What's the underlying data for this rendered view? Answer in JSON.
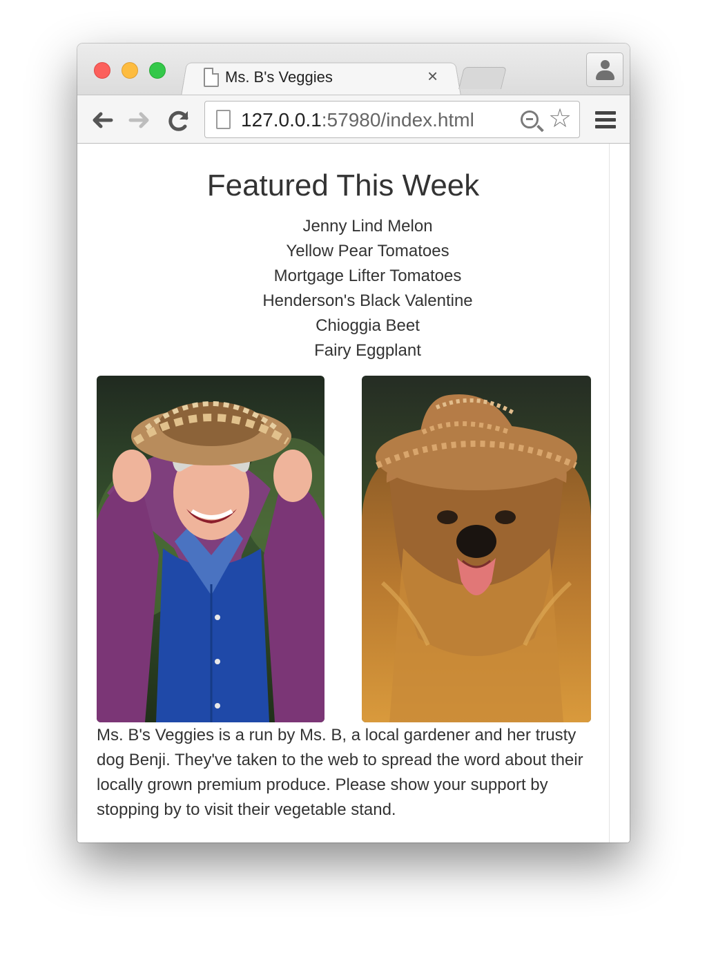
{
  "browser": {
    "tab_title": "Ms. B's Veggies",
    "tab_close": "×",
    "url_host": "127.0.0.1",
    "url_rest": ":57980/index.html",
    "icons": [
      "back-arrow-icon",
      "forward-arrow-icon",
      "reload-icon",
      "page-icon",
      "zoom-icon",
      "star-icon",
      "menu-icon",
      "profile-icon"
    ]
  },
  "page": {
    "heading": "Featured This Week",
    "featured_items": [
      "Jenny Lind Melon",
      "Yellow Pear Tomatoes",
      "Mortgage Lifter Tomatoes",
      "Henderson's Black Valentine",
      "Chioggia Beet",
      "Fairy Eggplant"
    ],
    "description": "Ms. B's Veggies is a run by Ms. B, a local gardener and her trusty dog Benji. They've taken to the web to spread the word about their locally grown premium produce. Please show your support by stopping by to visit their vegetable stand."
  }
}
